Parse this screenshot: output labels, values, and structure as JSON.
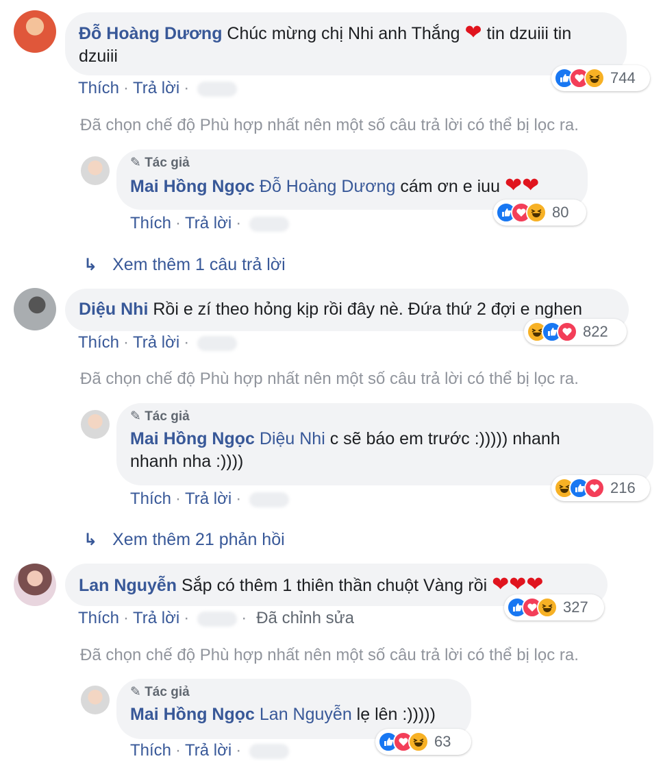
{
  "labels": {
    "like": "Thích",
    "reply": "Trả lời",
    "author": "Tác giả",
    "edited": "Đã chỉnh sửa",
    "filter_note": "Đã chọn chế độ Phù hợp nhất nên một số câu trả lời có thể bị lọc ra."
  },
  "colors": {
    "link": "#385898",
    "bubble": "#f2f3f5",
    "like": "#1877f2",
    "love": "#f33e58",
    "haha": "#f7b125"
  },
  "comments": [
    {
      "author": "Đỗ Hoàng Dương",
      "text_line1": "Chúc mừng chị Nhi anh Thắng",
      "text_after_heart": "tin dzuiii tin",
      "text_line2": "dzuiii",
      "reaction_icons": [
        "like",
        "love",
        "haha"
      ],
      "reaction_count": "744",
      "reply": {
        "author": "Mai Hồng Ngọc",
        "mention": "Đỗ Hoàng Dương",
        "text": "cám ơn e iuu",
        "reaction_icons": [
          "like",
          "love",
          "haha"
        ],
        "reaction_count": "80"
      },
      "more": "Xem thêm 1 câu trả lời"
    },
    {
      "author": "Diệu Nhi",
      "text_line1": "Rồi e zí theo hỏng kịp rồi đây nè. Đứa thứ 2 đợi e nghen",
      "reaction_icons": [
        "haha",
        "like",
        "love"
      ],
      "reaction_count": "822",
      "reply": {
        "author": "Mai Hồng Ngọc",
        "mention": "Diệu Nhi",
        "text": "c sẽ báo em trước :))))) nhanh",
        "text_line2": "nhanh nha :))))",
        "reaction_icons": [
          "haha",
          "like",
          "love"
        ],
        "reaction_count": "216"
      },
      "more": "Xem thêm 21 phản hồi"
    },
    {
      "author": "Lan Nguyễn",
      "text_line1": "Sắp có thêm 1 thiên thần chuột Vàng rồi",
      "reaction_icons": [
        "like",
        "love",
        "haha"
      ],
      "reaction_count": "327",
      "reply": {
        "author": "Mai Hồng Ngọc",
        "mention": "Lan Nguyễn",
        "text": "lẹ lên :)))))",
        "reaction_icons": [
          "like",
          "love",
          "haha"
        ],
        "reaction_count": "63"
      }
    }
  ]
}
